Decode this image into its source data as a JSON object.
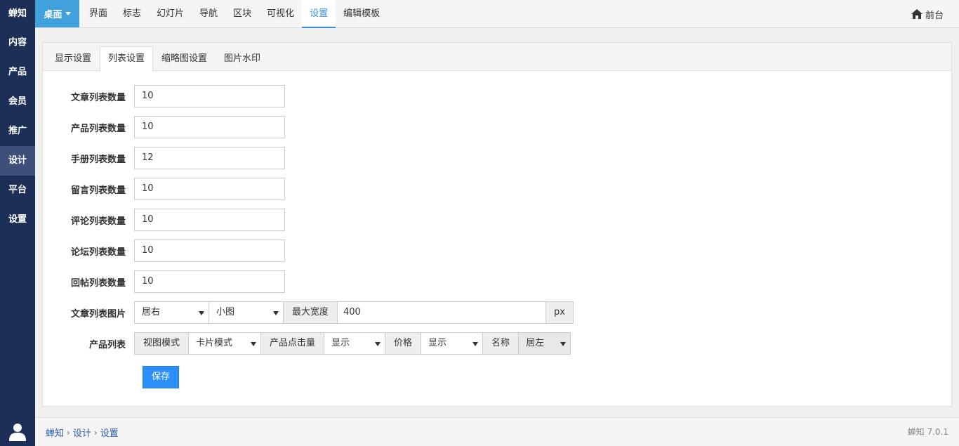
{
  "sidebar": {
    "brand": "蝉知",
    "items": [
      {
        "label": "内容",
        "active": false
      },
      {
        "label": "产品",
        "active": false
      },
      {
        "label": "会员",
        "active": false
      },
      {
        "label": "推广",
        "active": false
      },
      {
        "label": "设计",
        "active": true
      },
      {
        "label": "平台",
        "active": false
      },
      {
        "label": "设置",
        "active": false
      }
    ],
    "user_icon": "user-icon"
  },
  "topbar": {
    "desk_label": "桌面",
    "menu": [
      "界面",
      "标志",
      "幻灯片",
      "导航",
      "区块",
      "可视化",
      "设置",
      "编辑模板"
    ],
    "active_menu": "设置",
    "front_label": "前台",
    "front_icon": "home-icon"
  },
  "tabs": {
    "items": [
      "显示设置",
      "列表设置",
      "缩略图设置",
      "图片水印"
    ],
    "active": "列表设置"
  },
  "form": {
    "fields": [
      {
        "label": "文章列表数量",
        "value": "10"
      },
      {
        "label": "产品列表数量",
        "value": "10"
      },
      {
        "label": "手册列表数量",
        "value": "12"
      },
      {
        "label": "留言列表数量",
        "value": "10"
      },
      {
        "label": "评论列表数量",
        "value": "10"
      },
      {
        "label": "论坛列表数量",
        "value": "10"
      },
      {
        "label": "回帖列表数量",
        "value": "10"
      }
    ],
    "article_image": {
      "label": "文章列表图片",
      "position": "居右",
      "size": "小图",
      "max_width_label": "最大宽度",
      "max_width": "400",
      "unit": "px"
    },
    "product_list": {
      "label": "产品列表",
      "view_mode_label": "视图模式",
      "view_mode": "卡片模式",
      "hits_label": "产品点击量",
      "hits": "显示",
      "price_label": "价格",
      "price": "显示",
      "name_label": "名称",
      "name": "居左"
    },
    "save_label": "保存"
  },
  "footer": {
    "crumbs": [
      "蝉知",
      "设计",
      "设置"
    ],
    "version": "蝉知 7.0.1"
  },
  "colors": {
    "sidebar_bg": "#1b2f57",
    "accent": "#41a1dd",
    "primary_button": "#2c8ef8"
  }
}
